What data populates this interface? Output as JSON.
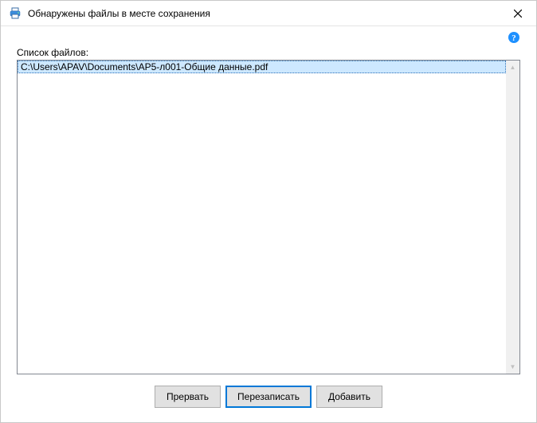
{
  "window": {
    "title": "Обнаружены файлы в месте сохранения"
  },
  "content": {
    "list_label": "Список файлов:",
    "files": [
      "C:\\Users\\APAV\\Documents\\АР5-л001-Общие данные.pdf"
    ]
  },
  "buttons": {
    "abort": "Прервать",
    "overwrite": "Перезаписать",
    "append": "Добавить"
  }
}
